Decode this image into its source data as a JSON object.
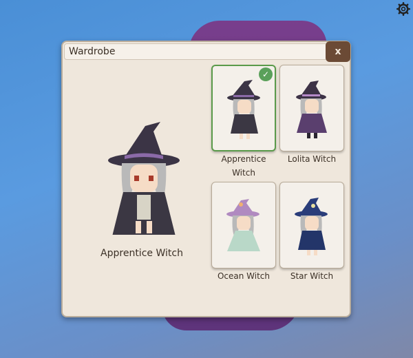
{
  "window": {
    "title": "Wardrobe",
    "close_label": "x"
  },
  "preview": {
    "label": "Apprentice Witch"
  },
  "outfits": [
    {
      "label": "Apprentice Witch",
      "selected": true,
      "hat": "#3b3445",
      "band": "#8b6aa8",
      "robe": "#3b3743"
    },
    {
      "label": "Lolita Witch",
      "selected": false,
      "hat": "#3d3246",
      "band": "#b58ac8",
      "robe": "#5a3f6e"
    },
    {
      "label": "Ocean Witch",
      "selected": false,
      "hat": "#b08ac0",
      "band": "#f0b070",
      "robe": "#b9d8c8"
    },
    {
      "label": "Star Witch",
      "selected": false,
      "hat": "#2a3d7a",
      "band": "#e8e0a0",
      "robe": "#233569"
    }
  ],
  "colors": {
    "panel_bg": "#efe7dc",
    "close_bg": "#6b4a35",
    "selected_border": "#5a9a4a"
  },
  "icons": {
    "settings": "gear-icon",
    "selected": "check-icon"
  }
}
